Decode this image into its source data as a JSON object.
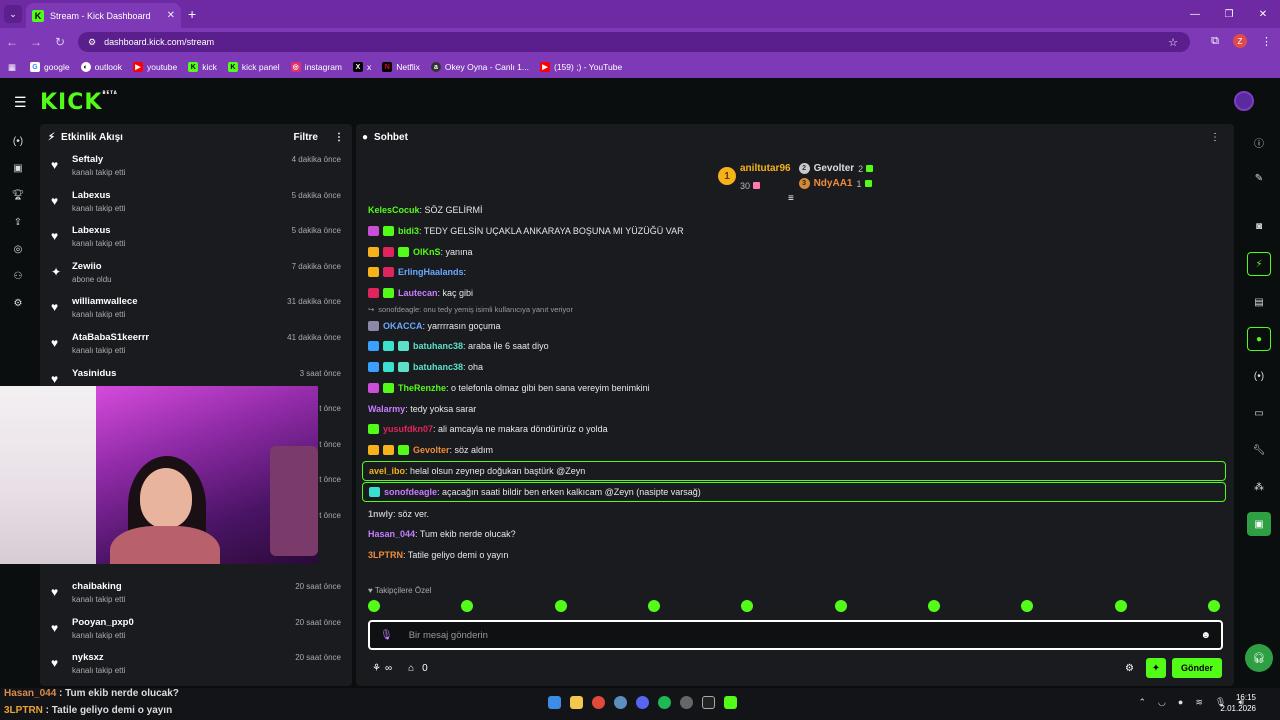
{
  "browser": {
    "tab_title": "Stream - Kick Dashboard",
    "url": "dashboard.kick.com/stream",
    "bookmarks": [
      {
        "label": "google",
        "color": "#ffffff"
      },
      {
        "label": "outlook",
        "color": "#ffffff"
      },
      {
        "label": "youtube",
        "color": "#ff0000"
      },
      {
        "label": "kick",
        "color": "#53fc18"
      },
      {
        "label": "kick panel",
        "color": "#53fc18"
      },
      {
        "label": "instagram",
        "color": "#e1306c"
      },
      {
        "label": "x",
        "color": "#000000"
      },
      {
        "label": "Netflix",
        "color": "#e50914"
      },
      {
        "label": "Okey Oyna - Canlı 1...",
        "color": "#333333"
      },
      {
        "label": "(159) ;) - YouTube",
        "color": "#ff0000"
      }
    ],
    "profile_initial": "Z"
  },
  "app": {
    "logo": "KICK",
    "logo_tag": "BETA"
  },
  "activity": {
    "title": "Etkinlik Akışı",
    "filter_label": "Filtre",
    "items": [
      {
        "name": "Seftaly",
        "action": "kanalı takip etti",
        "time": "4 dakika önce",
        "icon": "heart-icon"
      },
      {
        "name": "Labexus",
        "action": "kanalı takip etti",
        "time": "5 dakika önce",
        "icon": "heart-icon"
      },
      {
        "name": "Labexus",
        "action": "kanalı takip etti",
        "time": "5 dakika önce",
        "icon": "heart-icon"
      },
      {
        "name": "Zewiio",
        "action": "abone oldu",
        "time": "7 dakika önce",
        "icon": "sparkle-icon"
      },
      {
        "name": "williamwallece",
        "action": "kanalı takip etti",
        "time": "31 dakika önce",
        "icon": "heart-icon"
      },
      {
        "name": "AtaBabaS1keerrr",
        "action": "kanalı takip etti",
        "time": "41 dakika önce",
        "icon": "heart-icon"
      },
      {
        "name": "Yasinidus",
        "action": "",
        "time": "3 saat önce",
        "icon": "heart-icon"
      },
      {
        "name": "",
        "action": "",
        "time": "t önce",
        "icon": "heart-icon"
      },
      {
        "name": "",
        "action": "",
        "time": "t önce",
        "icon": "heart-icon"
      },
      {
        "name": "",
        "action": "",
        "time": "t önce",
        "icon": "heart-icon"
      },
      {
        "name": "",
        "action": "",
        "time": "t önce",
        "icon": "heart-icon"
      },
      {
        "name": "",
        "action": "kanalı takip etti",
        "time": "",
        "icon": "heart-icon"
      },
      {
        "name": "chaibaking",
        "action": "kanalı takip etti",
        "time": "20 saat önce",
        "icon": "heart-icon"
      },
      {
        "name": "Pooyan_pxp0",
        "action": "kanalı takip etti",
        "time": "20 saat önce",
        "icon": "heart-icon"
      },
      {
        "name": "nyksxz",
        "action": "kanalı takip etti",
        "time": "20 saat önce",
        "icon": "heart-icon"
      }
    ]
  },
  "chat": {
    "title": "Sohbet",
    "leaderboard": {
      "first": {
        "rank": "1",
        "name": "aniltutar96",
        "count": "30"
      },
      "second": {
        "name": "Gevolter",
        "count": "2"
      },
      "third": {
        "name": "NdyAA1",
        "count": "1"
      }
    },
    "messages": [
      {
        "user": "KelesCocuk",
        "text": ": SÖZ GELİRMİ",
        "color": "#53fc18",
        "badges": []
      },
      {
        "user": "bidi3",
        "text": ": TEDY GELSİN UÇAKLA ANKARAYA BOŞUNA MI YÜZÜĞÜ VAR",
        "color": "#53fc18",
        "badges": [
          "#c94fd6",
          "#53fc18"
        ]
      },
      {
        "user": "OlKnS",
        "text": ": yanına",
        "color": "#53fc18",
        "badges": [
          "#f5b21b",
          "#e0245e",
          "#53fc18"
        ]
      },
      {
        "user": "ErlingHaalands",
        "text": ":",
        "color": "#6aa8ff",
        "badges": [
          "#f5b21b",
          "#e0245e"
        ]
      },
      {
        "user": "Lautecan",
        "text": ": kaç gibi",
        "color": "#c77dff",
        "badges": [
          "#e0245e",
          "#53fc18"
        ]
      },
      {
        "user": "OKACCA",
        "text": ": yarrrrasın goçuma",
        "color": "#6aa8ff",
        "badges": [
          "#8a8aa8"
        ],
        "reply": "sonofdeagle: onu tedy yemiş isimli kullanıcıya yanıt veriyor"
      },
      {
        "user": "batuhanc38",
        "text": ": araba ile 6 saat diyo",
        "color": "#5ce0c8",
        "badges": [
          "#3aa0ff",
          "#3ae0d0",
          "#5ce0c8"
        ]
      },
      {
        "user": "batuhanc38",
        "text": ": oha",
        "color": "#5ce0c8",
        "badges": [
          "#3aa0ff",
          "#3ae0d0",
          "#5ce0c8"
        ]
      },
      {
        "user": "TheRenzhe",
        "text": ": o telefonla olmaz gibi ben sana vereyim benimkini",
        "color": "#53fc18",
        "badges": [
          "#c94fd6",
          "#53fc18"
        ]
      },
      {
        "user": "Walarmy",
        "text": ": tedy yoksa sarar",
        "color": "#c77dff",
        "badges": []
      },
      {
        "user": "yusufdkn07",
        "text": ": ali amcayla ne makara döndürürüz o yolda",
        "color": "#e0245e",
        "badges": [
          "#53fc18"
        ]
      },
      {
        "user": "Gevolter",
        "text": ": söz aldım",
        "color": "#f08c3a",
        "badges": [
          "#f5b21b",
          "#f5b21b",
          "#53fc18"
        ]
      },
      {
        "user": "avel_ibo",
        "text": ": helal olsun zeynep doğukan baştürk @Zeyn",
        "color": "#f5b21b",
        "badges": [],
        "highlight": true
      },
      {
        "user": "sonofdeagle",
        "text": ": açacağın saati bildir ben erken kalkıcam @Zeyn (nasipte varsağ)",
        "color": "#c77dff",
        "badges": [
          "#3ae0d0"
        ],
        "highlight": true
      },
      {
        "user": "1nwly",
        "text": ": söz ver.",
        "color": "#bbbbbb",
        "badges": []
      },
      {
        "user": "Hasan_044",
        "text": ": Tum ekib nerde olucak?",
        "color": "#c77dff",
        "badges": []
      },
      {
        "user": "3LPTRN",
        "text": ": Tatile geliyo demi o yayın",
        "color": "#f08c3a",
        "badges": []
      }
    ],
    "followers_only": "Takipçilere Özel",
    "input_placeholder": "Bir mesaj gönderin",
    "points_label": "∞",
    "store_count": "0",
    "send_label": "Gönder"
  },
  "stream_overlay": {
    "lines": [
      {
        "user": "Hasan_044",
        "text": " : Tum ekib nerde olucak?"
      },
      {
        "user": "3LPTRN",
        "text": " : Tatile geliyo demi o yayın"
      }
    ]
  },
  "taskbar": {
    "time": "16:15",
    "date": "2.01.2026"
  }
}
